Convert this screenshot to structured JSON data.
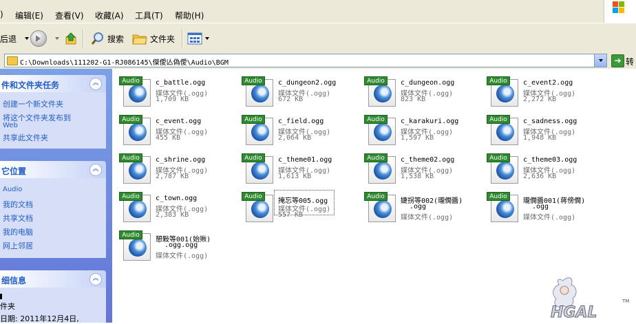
{
  "menubar": {
    "items": [
      "编辑(E)",
      "查看(V)",
      "收藏(A)",
      "工具(T)",
      "帮助(H)"
    ],
    "partial_item": ")"
  },
  "toolbar": {
    "back_label": "后退",
    "search_label": "搜索",
    "folders_label": "文件夹"
  },
  "address": {
    "path": "C:\\Downloads\\111202-G1-RJ086145\\傑僾亾偽僾\\Audio\\BGM",
    "go_label": "转"
  },
  "left_panel": {
    "tasks": {
      "title": "件和文件夹任务",
      "items": [
        "创建一个新文件夹",
        "将这个文件夹发布到",
        "Web",
        "共享此文件夹"
      ]
    },
    "places": {
      "title": "它位置",
      "items": [
        "Audio",
        "我的文档",
        "共享文档",
        "我的电脑",
        "网上邻居"
      ]
    },
    "details": {
      "title": "细信息",
      "line1": "件夹",
      "line2": "日期: 2011年12月4日,"
    }
  },
  "files": [
    {
      "name": "c_battle.ogg",
      "type": "媒体文件(.ogg)",
      "size": "1,709 KB"
    },
    {
      "name": "c_dungeon2.ogg",
      "type": "媒体文件(.ogg)",
      "size": "672 KB"
    },
    {
      "name": "c_dungeon.ogg",
      "type": "媒体文件(.ogg)",
      "size": "823 KB"
    },
    {
      "name": "c_event2.ogg",
      "type": "媒体文件(.ogg)",
      "size": "2,272 KB"
    },
    {
      "name": "c_event.ogg",
      "type": "媒体文件(.ogg)",
      "size": "455 KB"
    },
    {
      "name": "c_field.ogg",
      "type": "媒体文件(.ogg)",
      "size": "2,064 KB"
    },
    {
      "name": "c_karakuri.ogg",
      "type": "媒体文件(.ogg)",
      "size": "1,597 KB"
    },
    {
      "name": "c_sadness.ogg",
      "type": "媒体文件(.ogg)",
      "size": "1,948 KB"
    },
    {
      "name": "c_shrine.ogg",
      "type": "媒体文件(.ogg)",
      "size": "2,787 KB"
    },
    {
      "name": "c_theme01.ogg",
      "type": "媒体文件(.ogg)",
      "size": "1,613 KB"
    },
    {
      "name": "c_theme02.ogg",
      "type": "媒体文件(.ogg)",
      "size": "1,538 KB"
    },
    {
      "name": "c_theme03.ogg",
      "type": "媒体文件(.ogg)",
      "size": "2,636 KB"
    },
    {
      "name": "c_town.ogg",
      "type": "媒体文件(.ogg)",
      "size": "2,383 KB"
    },
    {
      "name": "掩忘等005.ogg",
      "type": "媒体文件(.ogg)",
      "size": "557 KB"
    },
    {
      "name": "婕拐等002(瓏僩醬)",
      "name2": ".ogg",
      "type": "媒体文件(.ogg)"
    },
    {
      "name": "瓏僩醬001(蒋傍僩)",
      "name2": ".ogg",
      "type": "媒体文件(.ogg)"
    },
    {
      "name": "憩敤等001(始揪)",
      "name2": ".ogg.ogg",
      "type": "媒体文件(.ogg)"
    }
  ],
  "icon_tag": "Audio",
  "watermark": {
    "text": "HGAL",
    "tm": "TM"
  },
  "colors": {
    "xp_panel_gradient_top": "#7ba2e7",
    "xp_panel_gradient_bottom": "#6375d6",
    "link_blue": "#215dc6",
    "audio_tag_green": "#2f8a2f",
    "chrome": "#ece9d8"
  }
}
